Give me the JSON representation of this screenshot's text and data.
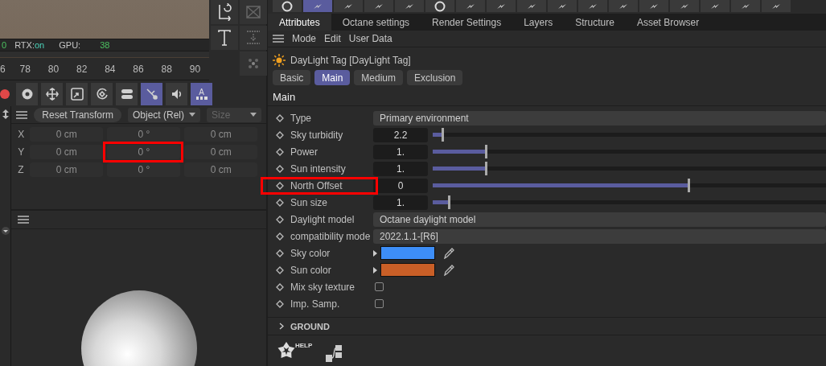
{
  "viewport_status": {
    "fps": "0",
    "rtx_label": "RTX:",
    "rtx_value": "on",
    "gpu_label": "GPU:",
    "gpu_value": "38"
  },
  "timeline": {
    "ticks": [
      "6",
      "78",
      "80",
      "82",
      "84",
      "86",
      "88",
      "90"
    ]
  },
  "anim_toolbar": [
    {
      "kind": "gear",
      "selected": false
    },
    {
      "kind": "move",
      "selected": false
    },
    {
      "kind": "scale",
      "selected": false
    },
    {
      "kind": "rotate",
      "selected": false
    },
    {
      "kind": "toggle",
      "selected": false
    },
    {
      "kind": "ik",
      "selected": true
    },
    {
      "kind": "sound",
      "selected": false
    },
    {
      "kind": "autokey",
      "selected": true,
      "label": "A"
    }
  ],
  "coordinates": {
    "reset_button": "Reset Transform",
    "mode": "Object (Rel)",
    "size_mode": "Size",
    "rows": [
      {
        "axis": "X",
        "position": "0 cm",
        "rotation": "0 °",
        "scale": "0 cm",
        "highlighted": false
      },
      {
        "axis": "Y",
        "position": "0 cm",
        "rotation": "0 °",
        "scale": "0 cm",
        "highlighted": true
      },
      {
        "axis": "Z",
        "position": "0 cm",
        "rotation": "0 °",
        "scale": "0 cm",
        "highlighted": false
      }
    ]
  },
  "render_toolbar": [
    {
      "kind": "ring",
      "selected": false
    },
    {
      "kind": "bolt",
      "selected": true
    },
    {
      "kind": "bolt",
      "selected": false
    },
    {
      "kind": "bolt",
      "selected": false
    },
    {
      "kind": "bolt",
      "selected": false
    },
    {
      "kind": "ring",
      "selected": false
    },
    {
      "kind": "bolt",
      "selected": false
    },
    {
      "kind": "bolt",
      "selected": false
    },
    {
      "kind": "bolt",
      "selected": false
    },
    {
      "kind": "bolt",
      "selected": false
    },
    {
      "kind": "bolt",
      "selected": false
    },
    {
      "kind": "bolt",
      "selected": false
    },
    {
      "kind": "bolt",
      "selected": false
    },
    {
      "kind": "bolt",
      "selected": false
    },
    {
      "kind": "bolt",
      "selected": false
    },
    {
      "kind": "bolt",
      "selected": false
    },
    {
      "kind": "bolt",
      "selected": false
    }
  ],
  "tabs": [
    {
      "label": "Attributes",
      "selected": true
    },
    {
      "label": "Octane settings",
      "selected": false
    },
    {
      "label": "Render Settings",
      "selected": false
    },
    {
      "label": "Layers",
      "selected": false
    },
    {
      "label": "Structure",
      "selected": false
    },
    {
      "label": "Asset Browser",
      "selected": false
    }
  ],
  "menu": [
    "Mode",
    "Edit",
    "User Data"
  ],
  "object_title": "DayLight Tag [DayLight Tag]",
  "subtabs": [
    {
      "label": "Basic",
      "selected": false
    },
    {
      "label": "Main",
      "selected": true
    },
    {
      "label": "Medium",
      "selected": false
    },
    {
      "label": "Exclusion",
      "selected": false
    }
  ],
  "section": "Main",
  "params": [
    {
      "kind": "dropdown",
      "label": "Type",
      "value": "Primary environment",
      "highlighted": false
    },
    {
      "kind": "slider",
      "label": "Sky turbidity",
      "value": "2.2",
      "level": 0.025,
      "highlighted": false
    },
    {
      "kind": "slider",
      "label": "Power",
      "value": "1.",
      "level": 0.135,
      "highlighted": false
    },
    {
      "kind": "slider",
      "label": "Sun intensity",
      "value": "1.",
      "level": 0.135,
      "highlighted": false
    },
    {
      "kind": "slider",
      "label": "North Offset",
      "value": "0",
      "level": 0.65,
      "highlighted": true
    },
    {
      "kind": "slider",
      "label": "Sun size",
      "value": "1.",
      "level": 0.04,
      "highlighted": false
    },
    {
      "kind": "dropdown",
      "label": "Daylight model",
      "value": "Octane daylight model",
      "highlighted": false
    },
    {
      "kind": "dropdown",
      "label": "compatibility mode",
      "value": "2022.1.1-[R6]",
      "highlighted": false
    },
    {
      "kind": "color",
      "label": "Sky color",
      "color": "#3d8ef8",
      "highlighted": false
    },
    {
      "kind": "color",
      "label": "Sun color",
      "color": "#c95f27",
      "highlighted": false
    },
    {
      "kind": "checkbox",
      "label": "Mix sky texture",
      "checked": false,
      "highlighted": false
    },
    {
      "kind": "checkbox",
      "label": "Imp. Samp.",
      "checked": false,
      "highlighted": false
    }
  ],
  "group": {
    "label": "GROUND",
    "expanded": false
  },
  "help_badge": "HELP"
}
